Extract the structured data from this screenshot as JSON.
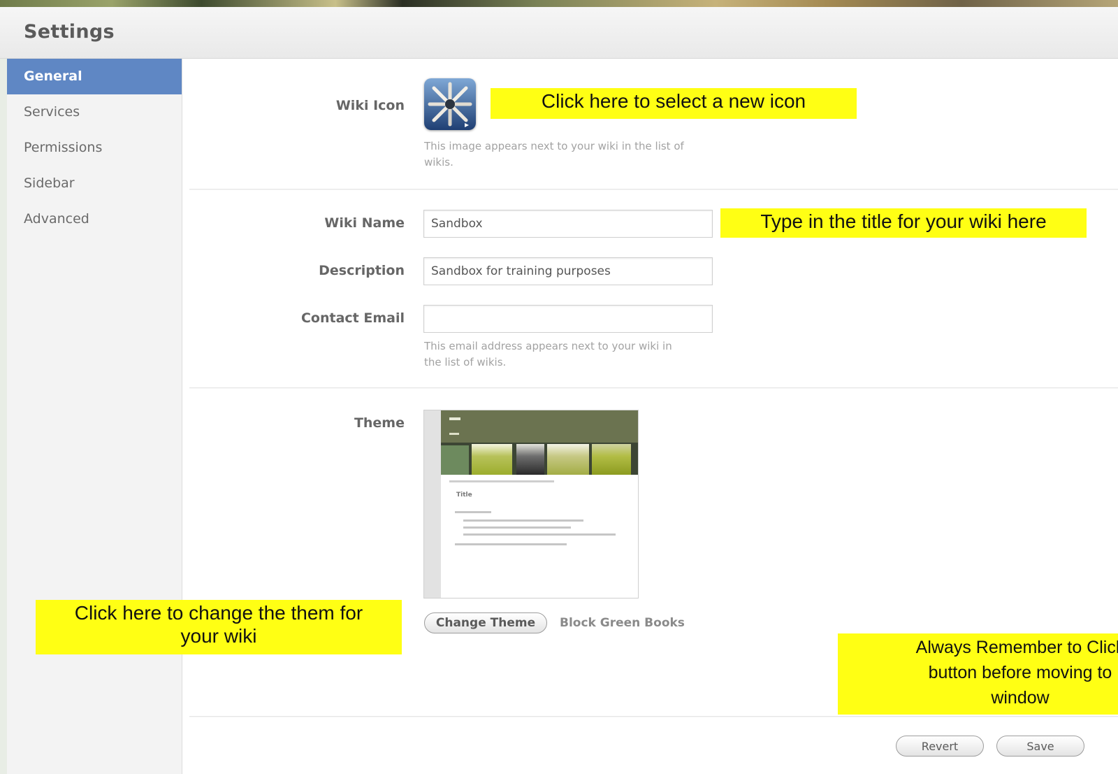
{
  "window": {
    "title": "Settings"
  },
  "sidebar": {
    "items": [
      {
        "label": "General",
        "active": true
      },
      {
        "label": "Services",
        "active": false
      },
      {
        "label": "Permissions",
        "active": false
      },
      {
        "label": "Sidebar",
        "active": false
      },
      {
        "label": "Advanced",
        "active": false
      }
    ]
  },
  "general": {
    "wiki_icon": {
      "label": "Wiki Icon",
      "hint": "This image appears next to your wiki in the list of wikis.",
      "icon": "wiki-pencils-icon"
    },
    "wiki_name": {
      "label": "Wiki Name",
      "value": "Sandbox"
    },
    "description": {
      "label": "Description",
      "value": "Sandbox for training purposes"
    },
    "contact_email": {
      "label": "Contact Email",
      "value": "",
      "hint": "This email address appears next to your wiki in the list of wikis."
    },
    "theme": {
      "label": "Theme",
      "change_button": "Change Theme",
      "current": "Block Green Books",
      "preview": {
        "title": "Title"
      }
    }
  },
  "footer": {
    "revert_label": "Revert",
    "save_label": "Save"
  },
  "annotations": {
    "icon": "Click here to select a new icon",
    "title": "Type in the title for your wiki here",
    "theme_line1": "Click here to change the them for",
    "theme_line2": "your wiki",
    "save_line1": "Always Remember to Click",
    "save_line2": "button before moving to",
    "save_line3": "window"
  },
  "colors": {
    "sidebar_active": "#5f87c4",
    "callout": "#ffff14",
    "theme_green": "#6b7350"
  }
}
